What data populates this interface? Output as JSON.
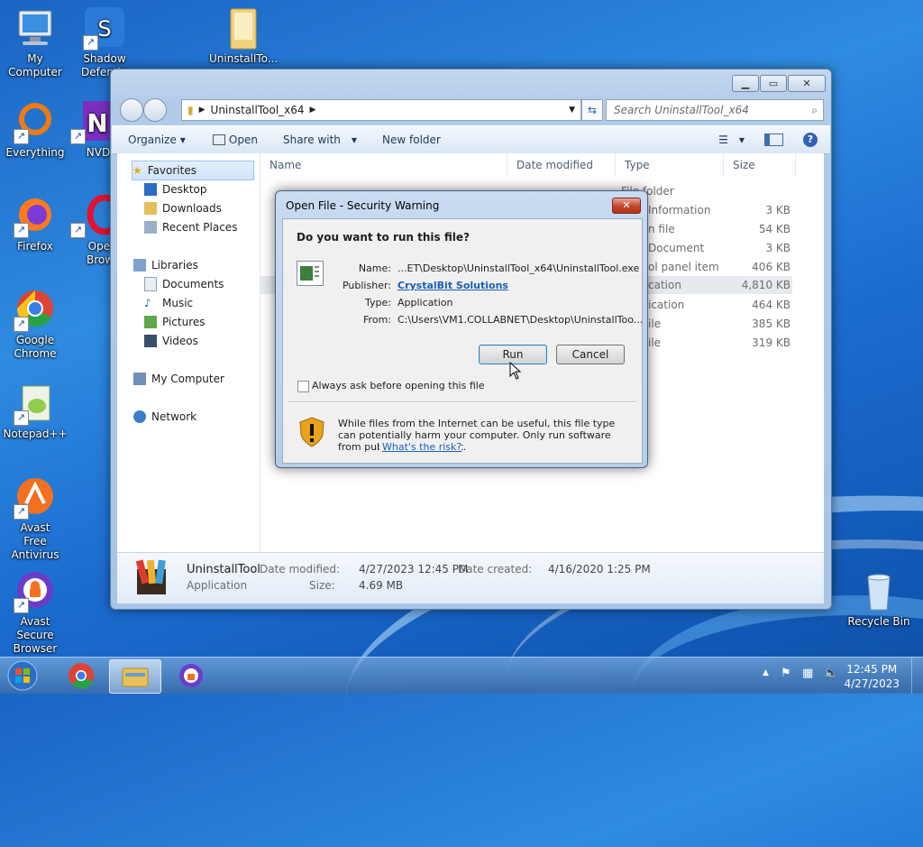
{
  "desktop": {
    "icons": [
      {
        "label": "My Computer"
      },
      {
        "label": "Shadow Defender"
      },
      {
        "label": "UninstallTo..."
      },
      {
        "label": "Everything"
      },
      {
        "label": "NVD"
      },
      {
        "label": "Firefox"
      },
      {
        "label": "Opera Browser"
      },
      {
        "label": "Google Chrome"
      },
      {
        "label": "Notepad++"
      },
      {
        "label": "Avast Free Antivirus"
      },
      {
        "label": "Avast Secure Browser"
      },
      {
        "label": "Recycle Bin"
      }
    ]
  },
  "explorer": {
    "address": "UninstallTool_x64",
    "search_placeholder": "Search UninstallTool_x64",
    "toolbar": {
      "organize": "Organize",
      "open": "Open",
      "share": "Share with",
      "new_folder": "New folder"
    },
    "nav": {
      "favorites": "Favorites",
      "desktop": "Desktop",
      "downloads": "Downloads",
      "recent": "Recent Places",
      "libraries": "Libraries",
      "documents": "Documents",
      "music": "Music",
      "pictures": "Pictures",
      "videos": "Videos",
      "computer": "My Computer",
      "network": "Network"
    },
    "columns": {
      "name": "Name",
      "date": "Date modified",
      "type": "Type",
      "size": "Size"
    },
    "rows": [
      {
        "type": "File folder",
        "size": ""
      },
      {
        "type": "Information",
        "size": "3 KB"
      },
      {
        "type": "n file",
        "size": "54 KB"
      },
      {
        "type": "Document",
        "size": "3 KB"
      },
      {
        "type": "ol panel item",
        "size": "406 KB"
      },
      {
        "type": "cation",
        "size": "4,810 KB"
      },
      {
        "type": "ication",
        "size": "464 KB"
      },
      {
        "type": "ile",
        "size": "385 KB"
      },
      {
        "type": "ile",
        "size": "319 KB"
      }
    ],
    "details": {
      "name": "UninstallTool",
      "kind": "Application",
      "modified_label": "Date modified:",
      "modified": "4/27/2023 12:45 PM",
      "created_label": "Date created:",
      "created": "4/16/2020 1:25 PM",
      "size_label": "Size:",
      "size": "4.69 MB"
    }
  },
  "dialog": {
    "title": "Open File - Security Warning",
    "question": "Do you want to run this file?",
    "name_label": "Name:",
    "name": "...ET\\Desktop\\UninstallTool_x64\\UninstallTool.exe",
    "publisher_label": "Publisher:",
    "publisher": "CrystalBit Solutions",
    "type_label": "Type:",
    "type": "Application",
    "from_label": "From:",
    "from": "C:\\Users\\VM1.COLLABNET\\Desktop\\UninstallToo...",
    "run": "Run",
    "cancel": "Cancel",
    "always_ask": "Always ask before opening this file",
    "warning": "While files from the Internet can be useful, this file type can potentially harm your computer. Only run software from publishers you trust.",
    "risk_link": "What's the risk?"
  },
  "taskbar": {
    "time": "12:45 PM",
    "date": "4/27/2023"
  }
}
